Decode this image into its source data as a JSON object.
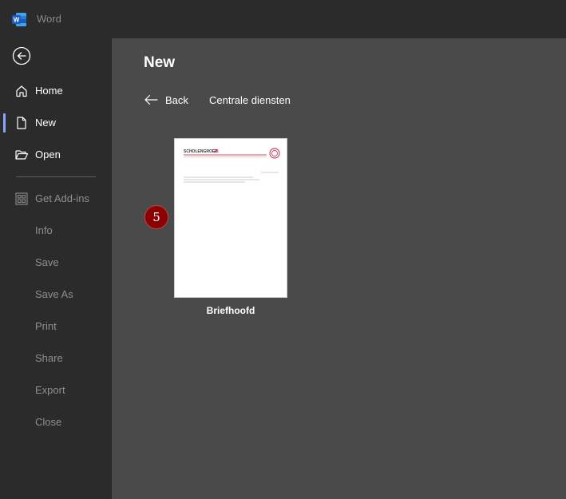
{
  "titlebar": {
    "app_name": "Word",
    "icon": "word-app-icon"
  },
  "sidebar": {
    "back_icon": "back-arrow-circle-icon",
    "items": [
      {
        "label": "Home",
        "icon": "home-icon",
        "state": "normal"
      },
      {
        "label": "New",
        "icon": "new-document-icon",
        "state": "active"
      },
      {
        "label": "Open",
        "icon": "open-folder-icon",
        "state": "normal"
      },
      {
        "label": "Get Add-ins",
        "icon": "addins-grid-icon",
        "state": "dim"
      },
      {
        "label": "Info",
        "state": "dim"
      },
      {
        "label": "Save",
        "state": "dim"
      },
      {
        "label": "Save As",
        "state": "dim"
      },
      {
        "label": "Print",
        "state": "dim"
      },
      {
        "label": "Share",
        "state": "dim"
      },
      {
        "label": "Export",
        "state": "dim"
      },
      {
        "label": "Close",
        "state": "dim"
      }
    ]
  },
  "main": {
    "title": "New",
    "back_label": "Back",
    "breadcrumb": "Centrale diensten",
    "templates": [
      {
        "name": "Briefhoofd",
        "thumbnail": {
          "logo_text": "SCHOLENGROEP",
          "logo_number": "25"
        }
      }
    ],
    "step_badge": "5"
  },
  "colors": {
    "sidebar_bg": "#2b2b2b",
    "main_bg": "#4a4a4a",
    "accent": "#8aa4ff",
    "badge": "#8b0000",
    "word_blue": "#185abd"
  }
}
